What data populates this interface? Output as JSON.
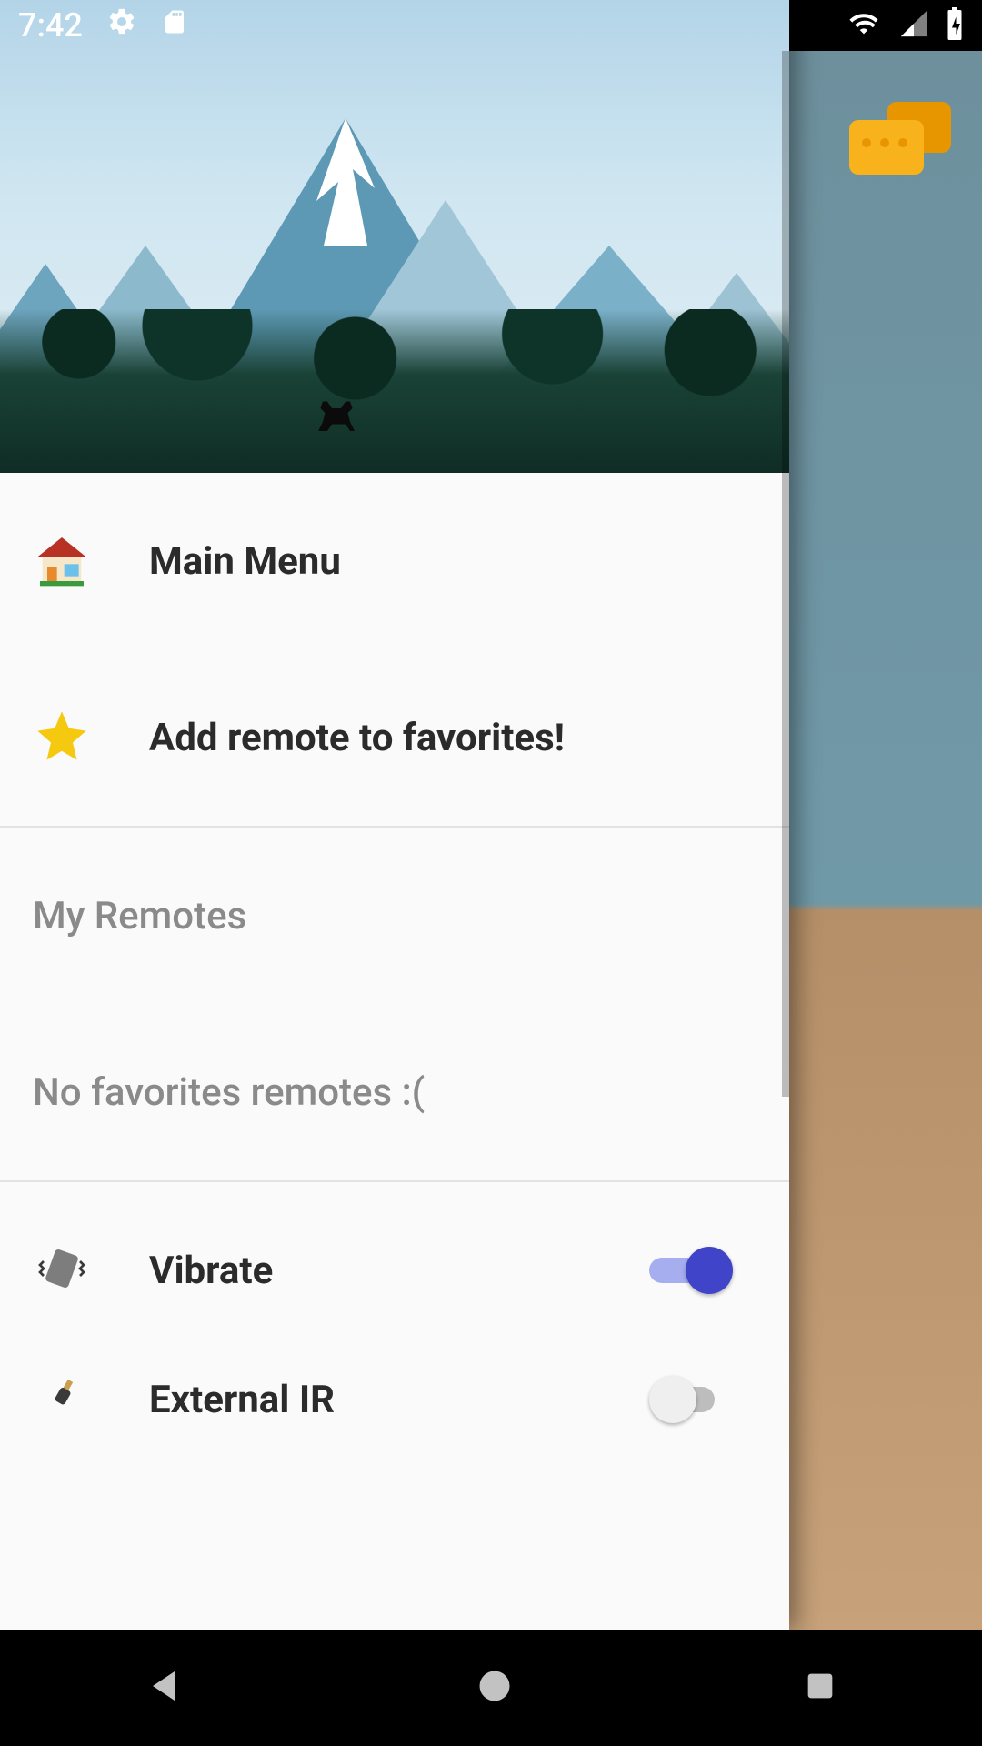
{
  "status": {
    "time": "7:42",
    "settings_icon": "settings",
    "sd_icon": "sd-card",
    "wifi_icon": "wifi",
    "cell_icon": "cell-signal",
    "batt_icon": "battery-charging"
  },
  "drawer": {
    "main": {
      "label": "Main Menu",
      "icon": "house"
    },
    "fav": {
      "label": "Add remote to favorites!",
      "icon": "star"
    },
    "section_my_remotes": "My Remotes",
    "empty_remotes": "No favorites remotes :(",
    "vibrate": {
      "label": "Vibrate",
      "icon": "vibrate",
      "on": true
    },
    "external_ir": {
      "label": "External IR",
      "icon": "plug",
      "on": false
    }
  },
  "colors": {
    "accent": "#3f44c8",
    "star": "#f5c90f"
  },
  "nav": {
    "back": "back",
    "home": "home",
    "recent": "recent"
  }
}
